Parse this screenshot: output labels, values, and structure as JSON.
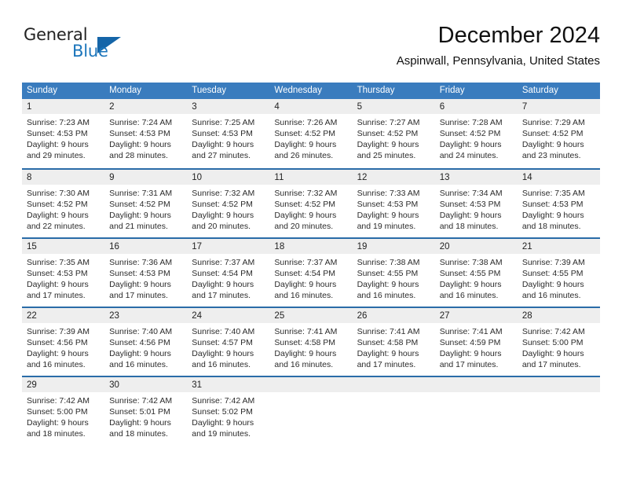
{
  "logo": {
    "word_one": "General",
    "word_two": "Blue",
    "triangle_icon": "triangle-icon",
    "accent_color": "#1b75bb",
    "triangle_color": "#1565a8"
  },
  "header": {
    "title": "December 2024",
    "location": "Aspinwall, Pennsylvania, United States"
  },
  "theme": {
    "header_blue": "#3a7cbe",
    "row_border_blue": "#2a6ca8",
    "day_band_gray": "#eeeeee"
  },
  "weekdays": [
    "Sunday",
    "Monday",
    "Tuesday",
    "Wednesday",
    "Thursday",
    "Friday",
    "Saturday"
  ],
  "weeks": [
    [
      {
        "day": "1",
        "sunrise": "Sunrise: 7:23 AM",
        "sunset": "Sunset: 4:53 PM",
        "daylight_1": "Daylight: 9 hours",
        "daylight_2": "and 29 minutes."
      },
      {
        "day": "2",
        "sunrise": "Sunrise: 7:24 AM",
        "sunset": "Sunset: 4:53 PM",
        "daylight_1": "Daylight: 9 hours",
        "daylight_2": "and 28 minutes."
      },
      {
        "day": "3",
        "sunrise": "Sunrise: 7:25 AM",
        "sunset": "Sunset: 4:53 PM",
        "daylight_1": "Daylight: 9 hours",
        "daylight_2": "and 27 minutes."
      },
      {
        "day": "4",
        "sunrise": "Sunrise: 7:26 AM",
        "sunset": "Sunset: 4:52 PM",
        "daylight_1": "Daylight: 9 hours",
        "daylight_2": "and 26 minutes."
      },
      {
        "day": "5",
        "sunrise": "Sunrise: 7:27 AM",
        "sunset": "Sunset: 4:52 PM",
        "daylight_1": "Daylight: 9 hours",
        "daylight_2": "and 25 minutes."
      },
      {
        "day": "6",
        "sunrise": "Sunrise: 7:28 AM",
        "sunset": "Sunset: 4:52 PM",
        "daylight_1": "Daylight: 9 hours",
        "daylight_2": "and 24 minutes."
      },
      {
        "day": "7",
        "sunrise": "Sunrise: 7:29 AM",
        "sunset": "Sunset: 4:52 PM",
        "daylight_1": "Daylight: 9 hours",
        "daylight_2": "and 23 minutes."
      }
    ],
    [
      {
        "day": "8",
        "sunrise": "Sunrise: 7:30 AM",
        "sunset": "Sunset: 4:52 PM",
        "daylight_1": "Daylight: 9 hours",
        "daylight_2": "and 22 minutes."
      },
      {
        "day": "9",
        "sunrise": "Sunrise: 7:31 AM",
        "sunset": "Sunset: 4:52 PM",
        "daylight_1": "Daylight: 9 hours",
        "daylight_2": "and 21 minutes."
      },
      {
        "day": "10",
        "sunrise": "Sunrise: 7:32 AM",
        "sunset": "Sunset: 4:52 PM",
        "daylight_1": "Daylight: 9 hours",
        "daylight_2": "and 20 minutes."
      },
      {
        "day": "11",
        "sunrise": "Sunrise: 7:32 AM",
        "sunset": "Sunset: 4:52 PM",
        "daylight_1": "Daylight: 9 hours",
        "daylight_2": "and 20 minutes."
      },
      {
        "day": "12",
        "sunrise": "Sunrise: 7:33 AM",
        "sunset": "Sunset: 4:53 PM",
        "daylight_1": "Daylight: 9 hours",
        "daylight_2": "and 19 minutes."
      },
      {
        "day": "13",
        "sunrise": "Sunrise: 7:34 AM",
        "sunset": "Sunset: 4:53 PM",
        "daylight_1": "Daylight: 9 hours",
        "daylight_2": "and 18 minutes."
      },
      {
        "day": "14",
        "sunrise": "Sunrise: 7:35 AM",
        "sunset": "Sunset: 4:53 PM",
        "daylight_1": "Daylight: 9 hours",
        "daylight_2": "and 18 minutes."
      }
    ],
    [
      {
        "day": "15",
        "sunrise": "Sunrise: 7:35 AM",
        "sunset": "Sunset: 4:53 PM",
        "daylight_1": "Daylight: 9 hours",
        "daylight_2": "and 17 minutes."
      },
      {
        "day": "16",
        "sunrise": "Sunrise: 7:36 AM",
        "sunset": "Sunset: 4:53 PM",
        "daylight_1": "Daylight: 9 hours",
        "daylight_2": "and 17 minutes."
      },
      {
        "day": "17",
        "sunrise": "Sunrise: 7:37 AM",
        "sunset": "Sunset: 4:54 PM",
        "daylight_1": "Daylight: 9 hours",
        "daylight_2": "and 17 minutes."
      },
      {
        "day": "18",
        "sunrise": "Sunrise: 7:37 AM",
        "sunset": "Sunset: 4:54 PM",
        "daylight_1": "Daylight: 9 hours",
        "daylight_2": "and 16 minutes."
      },
      {
        "day": "19",
        "sunrise": "Sunrise: 7:38 AM",
        "sunset": "Sunset: 4:55 PM",
        "daylight_1": "Daylight: 9 hours",
        "daylight_2": "and 16 minutes."
      },
      {
        "day": "20",
        "sunrise": "Sunrise: 7:38 AM",
        "sunset": "Sunset: 4:55 PM",
        "daylight_1": "Daylight: 9 hours",
        "daylight_2": "and 16 minutes."
      },
      {
        "day": "21",
        "sunrise": "Sunrise: 7:39 AM",
        "sunset": "Sunset: 4:55 PM",
        "daylight_1": "Daylight: 9 hours",
        "daylight_2": "and 16 minutes."
      }
    ],
    [
      {
        "day": "22",
        "sunrise": "Sunrise: 7:39 AM",
        "sunset": "Sunset: 4:56 PM",
        "daylight_1": "Daylight: 9 hours",
        "daylight_2": "and 16 minutes."
      },
      {
        "day": "23",
        "sunrise": "Sunrise: 7:40 AM",
        "sunset": "Sunset: 4:56 PM",
        "daylight_1": "Daylight: 9 hours",
        "daylight_2": "and 16 minutes."
      },
      {
        "day": "24",
        "sunrise": "Sunrise: 7:40 AM",
        "sunset": "Sunset: 4:57 PM",
        "daylight_1": "Daylight: 9 hours",
        "daylight_2": "and 16 minutes."
      },
      {
        "day": "25",
        "sunrise": "Sunrise: 7:41 AM",
        "sunset": "Sunset: 4:58 PM",
        "daylight_1": "Daylight: 9 hours",
        "daylight_2": "and 16 minutes."
      },
      {
        "day": "26",
        "sunrise": "Sunrise: 7:41 AM",
        "sunset": "Sunset: 4:58 PM",
        "daylight_1": "Daylight: 9 hours",
        "daylight_2": "and 17 minutes."
      },
      {
        "day": "27",
        "sunrise": "Sunrise: 7:41 AM",
        "sunset": "Sunset: 4:59 PM",
        "daylight_1": "Daylight: 9 hours",
        "daylight_2": "and 17 minutes."
      },
      {
        "day": "28",
        "sunrise": "Sunrise: 7:42 AM",
        "sunset": "Sunset: 5:00 PM",
        "daylight_1": "Daylight: 9 hours",
        "daylight_2": "and 17 minutes."
      }
    ],
    [
      {
        "day": "29",
        "sunrise": "Sunrise: 7:42 AM",
        "sunset": "Sunset: 5:00 PM",
        "daylight_1": "Daylight: 9 hours",
        "daylight_2": "and 18 minutes."
      },
      {
        "day": "30",
        "sunrise": "Sunrise: 7:42 AM",
        "sunset": "Sunset: 5:01 PM",
        "daylight_1": "Daylight: 9 hours",
        "daylight_2": "and 18 minutes."
      },
      {
        "day": "31",
        "sunrise": "Sunrise: 7:42 AM",
        "sunset": "Sunset: 5:02 PM",
        "daylight_1": "Daylight: 9 hours",
        "daylight_2": "and 19 minutes."
      },
      {
        "day": "",
        "sunrise": "",
        "sunset": "",
        "daylight_1": "",
        "daylight_2": ""
      },
      {
        "day": "",
        "sunrise": "",
        "sunset": "",
        "daylight_1": "",
        "daylight_2": ""
      },
      {
        "day": "",
        "sunrise": "",
        "sunset": "",
        "daylight_1": "",
        "daylight_2": ""
      },
      {
        "day": "",
        "sunrise": "",
        "sunset": "",
        "daylight_1": "",
        "daylight_2": ""
      }
    ]
  ]
}
